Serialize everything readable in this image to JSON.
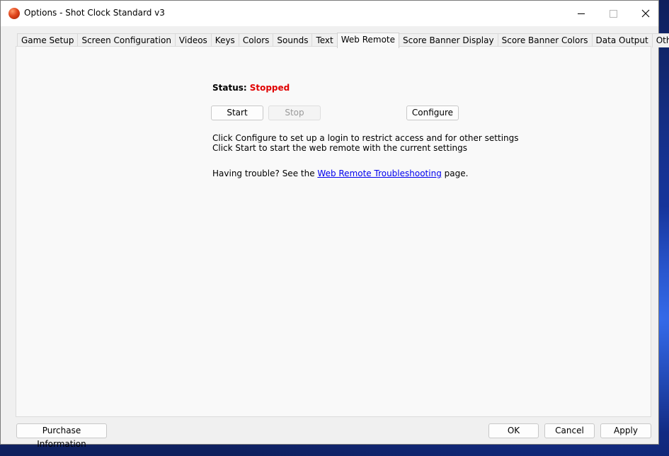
{
  "window": {
    "title": "Options - Shot Clock Standard v3"
  },
  "tabs": [
    {
      "label": "Game Setup"
    },
    {
      "label": "Screen Configuration"
    },
    {
      "label": "Videos"
    },
    {
      "label": "Keys"
    },
    {
      "label": "Colors"
    },
    {
      "label": "Sounds"
    },
    {
      "label": "Text"
    },
    {
      "label": "Web Remote",
      "active": true
    },
    {
      "label": "Score Banner Display"
    },
    {
      "label": "Score Banner Colors"
    },
    {
      "label": "Data Output"
    },
    {
      "label": "Other"
    }
  ],
  "web_remote": {
    "status_label": "Status:",
    "status_value": "Stopped",
    "status_color": "#e00000",
    "start_label": "Start",
    "stop_label": "Stop",
    "configure_label": "Configure",
    "info_line_1": "Click Configure to set up a login to restrict access and for other settings",
    "info_line_2": "Click Start to start the web remote with the current settings",
    "trouble_prefix": "Having trouble?  See the ",
    "trouble_link": "Web Remote Troubleshooting",
    "trouble_suffix": " page."
  },
  "footer": {
    "purchase_label": "Purchase Information",
    "ok_label": "OK",
    "cancel_label": "Cancel",
    "apply_label": "Apply"
  },
  "icons": {
    "app": "shot-clock-ball-icon",
    "minimize": "minimize-icon",
    "maximize": "maximize-icon",
    "close": "close-icon"
  }
}
